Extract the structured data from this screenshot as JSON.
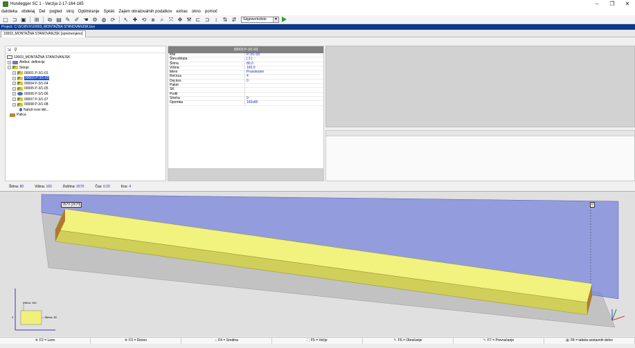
{
  "window": {
    "title": "Hundegger SC 1 - Verzija 2-17-164-185",
    "controls": [
      "–",
      "❐",
      "✕"
    ]
  },
  "menu": [
    "datoteka",
    "obdelaj",
    "Del",
    "pogled",
    "stroj",
    "Optimiranje",
    "Spiski",
    "Zajem obratovalnih podatkov",
    "extras",
    "okno",
    "pomoč"
  ],
  "toolbar": {
    "icons": [
      "new-icon",
      "open-icon",
      "save-icon",
      "grid-icon",
      "copy-icon",
      "paste-icon",
      "pen-icon",
      "pen2-icon",
      "hand-icon",
      "adjust-icon",
      "globe-icon",
      "refresh-icon",
      "pointer-icon",
      "cross-icon",
      "rotate-icon",
      "layers-icon",
      "zoom-icon",
      "fit-icon",
      "move-icon",
      "tools-icon",
      "join-icon",
      "split-icon",
      "dim-icon",
      "dim2-icon",
      "dim3-icon"
    ],
    "combo_value": "Sägewerksliste"
  },
  "project": {
    "path": "Project: C:\\SC\\BVX\\10003_MONTAŽNA STANOVANJSK.bvx",
    "tab": "10003_MONTAŽNA STANOVANJSK [spremenjeno]"
  },
  "tree": {
    "root": "10003_MONTAŽNA STANOVANJSK",
    "attr": "Atribut. definicije",
    "sklopi": "Sklopi",
    "items": [
      {
        "label": "00001  P-3/1-01",
        "selected": false
      },
      {
        "label": "00003  P-3/1-03",
        "selected": true
      },
      {
        "label": "00004  P-3/1-04",
        "selected": false
      },
      {
        "label": "00005  P-3/1-05",
        "selected": false
      },
      {
        "label": "00006  P-3/1-06",
        "selected": false
      },
      {
        "label": "00007  P-3/1-07",
        "selected": false
      },
      {
        "label": "00008  P-3/1-08",
        "selected": false
      }
    ],
    "new_item": "Naloži novi del...",
    "palica": "Palica"
  },
  "props": {
    "header": "00003  P-3/1-03",
    "rows": [
      {
        "k": "Ime",
        "v": "P-3/1-03"
      },
      {
        "k": "Štev.sklopa",
        "v": "[ 3 ]"
      },
      {
        "k": "Širina",
        "v": "80,0"
      },
      {
        "k": "Višina",
        "v": "160,0"
      },
      {
        "k": "Mere",
        "v": "Pravokoten"
      },
      {
        "k": "Ref.kos",
        "v": "4"
      },
      {
        "k": "Dej.kos",
        "v": "0"
      },
      {
        "k": "Paket",
        "v": ""
      },
      {
        "k": "SK",
        "v": ""
      },
      {
        "k": "Profil",
        "v": ""
      },
      {
        "k": "Streha",
        "v": "0"
      },
      {
        "k": "Opomba",
        "v": "160x80"
      }
    ]
  },
  "status": [
    {
      "label": "Širina:",
      "value": "80"
    },
    {
      "label": "Višina:",
      "value": "160"
    },
    {
      "label": "Dolžina:",
      "value": "2670"
    },
    {
      "label": "Čas:",
      "value": "0:20"
    },
    {
      "label": "Kos:",
      "value": "4"
    }
  ],
  "viewport": {
    "dim_label": "2670 [2670]",
    "zero_label": "0",
    "mini_visina": "Višina: 160",
    "mini_sirina": "Širina: 80",
    "mini_4": "4",
    "mini_2": "2",
    "mini_3": "3",
    "colors": {
      "beam": "#f0f07a",
      "beam_side": "#d8d860",
      "plane": "#6a78d6",
      "shadow": "#bdbdbd"
    }
  },
  "fkeys": [
    {
      "icon": "move-left-icon",
      "glyph": "✥",
      "label": "F2 = Levo"
    },
    {
      "icon": "move-right-icon",
      "glyph": "✥",
      "label": "F3 = Desno"
    },
    {
      "icon": "center-icon",
      "glyph": "⌂",
      "label": "F4 = Sredina"
    },
    {
      "icon": "enlarge-icon",
      "glyph": "⛶",
      "label": "F5 = Večje"
    },
    {
      "icon": "turn-icon",
      "glyph": "✎",
      "label": "F6 = Obračanje"
    },
    {
      "icon": "flip-icon",
      "glyph": "✎",
      "label": "F7 = Prevračanje"
    },
    {
      "icon": "table-icon",
      "glyph": "▦",
      "label": "F8 = tabela sestavnih delov"
    }
  ]
}
